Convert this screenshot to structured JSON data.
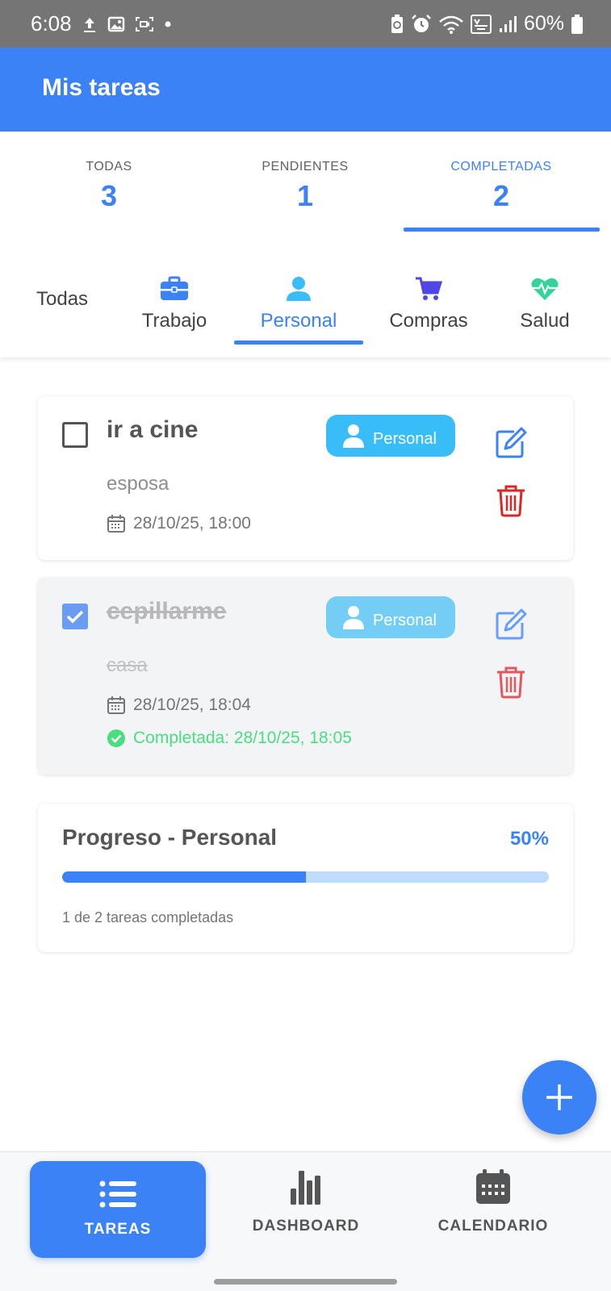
{
  "status_bar": {
    "time": "6:08",
    "battery": "60%"
  },
  "app_bar": {
    "title": "Mis tareas"
  },
  "stats": [
    {
      "label": "TODAS",
      "value": "3"
    },
    {
      "label": "PENDIENTES",
      "value": "1"
    },
    {
      "label": "COMPLETADAS",
      "value": "2",
      "active": true
    }
  ],
  "categories": {
    "all_label": "Todas",
    "items": [
      {
        "label": "Trabajo",
        "icon": "briefcase-icon",
        "color": "#3b82f6"
      },
      {
        "label": "Personal",
        "icon": "person-icon",
        "color": "#38bdf8",
        "active": true
      },
      {
        "label": "Compras",
        "icon": "cart-icon",
        "color": "#4f46e5"
      },
      {
        "label": "Salud",
        "icon": "heart-pulse-icon",
        "color": "#34d399"
      }
    ]
  },
  "tasks": [
    {
      "title": "ir a cine",
      "description": "esposa",
      "category": "Personal",
      "date": "28/10/25, 18:00",
      "completed": false
    },
    {
      "title": "cepillarme",
      "description": "casa",
      "category": "Personal",
      "date": "28/10/25, 18:04",
      "completed": true,
      "completed_text": "Completada: 28/10/25, 18:05"
    }
  ],
  "progress": {
    "title": "Progreso - Personal",
    "percent_label": "50%",
    "fraction": 0.5,
    "caption": "1 de 2 tareas completadas"
  },
  "bottom_nav": [
    {
      "label": "TAREAS",
      "icon": "list-icon",
      "active": true
    },
    {
      "label": "DASHBOARD",
      "icon": "bar-chart-icon"
    },
    {
      "label": "CALENDARIO",
      "icon": "calendar-icon"
    }
  ],
  "colors": {
    "primary": "#3b82f6",
    "personal_badge": "#38bdf8",
    "delete": "#dc2626",
    "completed": "#4ade80"
  }
}
